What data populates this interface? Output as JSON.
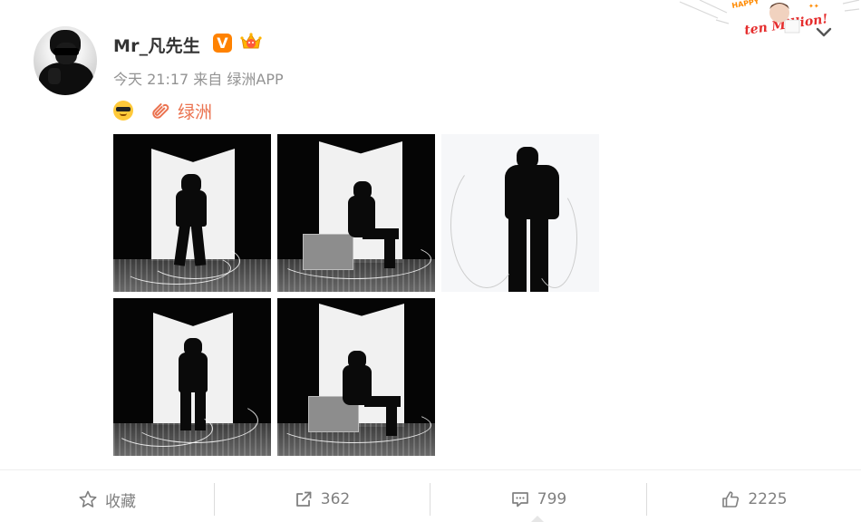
{
  "post": {
    "username": "Mr_凡先生",
    "verified_badge": "V",
    "meta": "今天 21:17 来自 绿洲APP",
    "link_label": "绿洲",
    "images": [
      {
        "id": 1,
        "scene": "standing-black-bg"
      },
      {
        "id": 2,
        "scene": "seated-black-bg"
      },
      {
        "id": 3,
        "scene": "standing-white-bg"
      },
      {
        "id": 4,
        "scene": "standing-black-bg"
      },
      {
        "id": 5,
        "scene": "seated-black-bg"
      }
    ]
  },
  "actions": {
    "favorite_label": "收藏",
    "repost_count": "362",
    "comment_count": "799",
    "like_count": "2225"
  },
  "decoration": {
    "banner_text": "ten Million!",
    "happy_text": "HAPPY"
  },
  "colors": {
    "link": "#eb7350",
    "badge": "#ff8200",
    "meta_text": "#939393",
    "action_text": "#808080"
  }
}
